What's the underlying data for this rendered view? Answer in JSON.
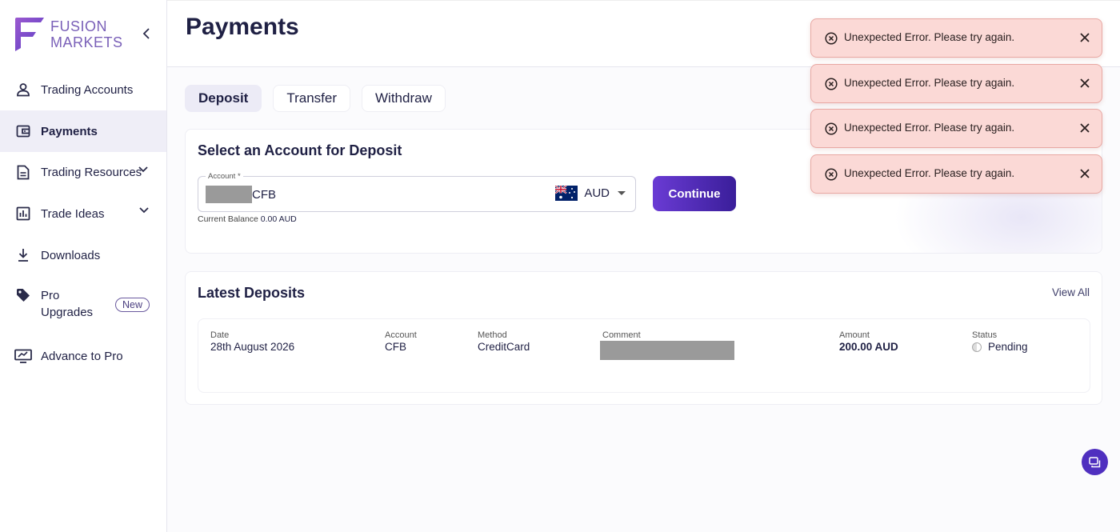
{
  "brand": {
    "line1": "FUSION",
    "line2": "MARKETS"
  },
  "sidebar": {
    "items": [
      {
        "label": "Trading Accounts",
        "icon": "user-icon"
      },
      {
        "label": "Payments",
        "icon": "wallet-icon",
        "active": true
      },
      {
        "label": "Trading Resources",
        "icon": "document-icon",
        "expandable": true
      },
      {
        "label": "Trade Ideas",
        "icon": "chart-icon",
        "expandable": true
      },
      {
        "label": "Downloads",
        "icon": "download-icon"
      },
      {
        "label": "Pro Upgrades",
        "icon": "tag-icon",
        "badge": "New"
      },
      {
        "label": "Advance to Pro",
        "icon": "monitor-icon"
      }
    ]
  },
  "page": {
    "title": "Payments"
  },
  "tabs": [
    {
      "label": "Deposit",
      "active": true
    },
    {
      "label": "Transfer"
    },
    {
      "label": "Withdraw"
    }
  ],
  "deposit": {
    "title": "Select an Account for Deposit",
    "account_label": "Account *",
    "account_value": "CFB",
    "currency": "AUD",
    "balance_label": "Current Balance",
    "balance_value": "0.00 AUD",
    "continue_label": "Continue"
  },
  "latest": {
    "title": "Latest Deposits",
    "view_all": "View All",
    "headers": {
      "date": "Date",
      "account": "Account",
      "method": "Method",
      "comment": "Comment",
      "amount": "Amount",
      "status": "Status"
    },
    "row": {
      "date": "28th August 2026",
      "account": "CFB",
      "method": "CreditCard",
      "amount": "200.00 AUD",
      "status": "Pending"
    }
  },
  "toasts": [
    {
      "message": "Unexpected Error. Please try again."
    },
    {
      "message": "Unexpected Error. Please try again."
    },
    {
      "message": "Unexpected Error. Please try again."
    },
    {
      "message": "Unexpected Error. Please try again."
    }
  ],
  "colors": {
    "accent": "#4f2fbf",
    "toast_bg": "#fbd9d6",
    "active_nav": "#efeef7"
  }
}
